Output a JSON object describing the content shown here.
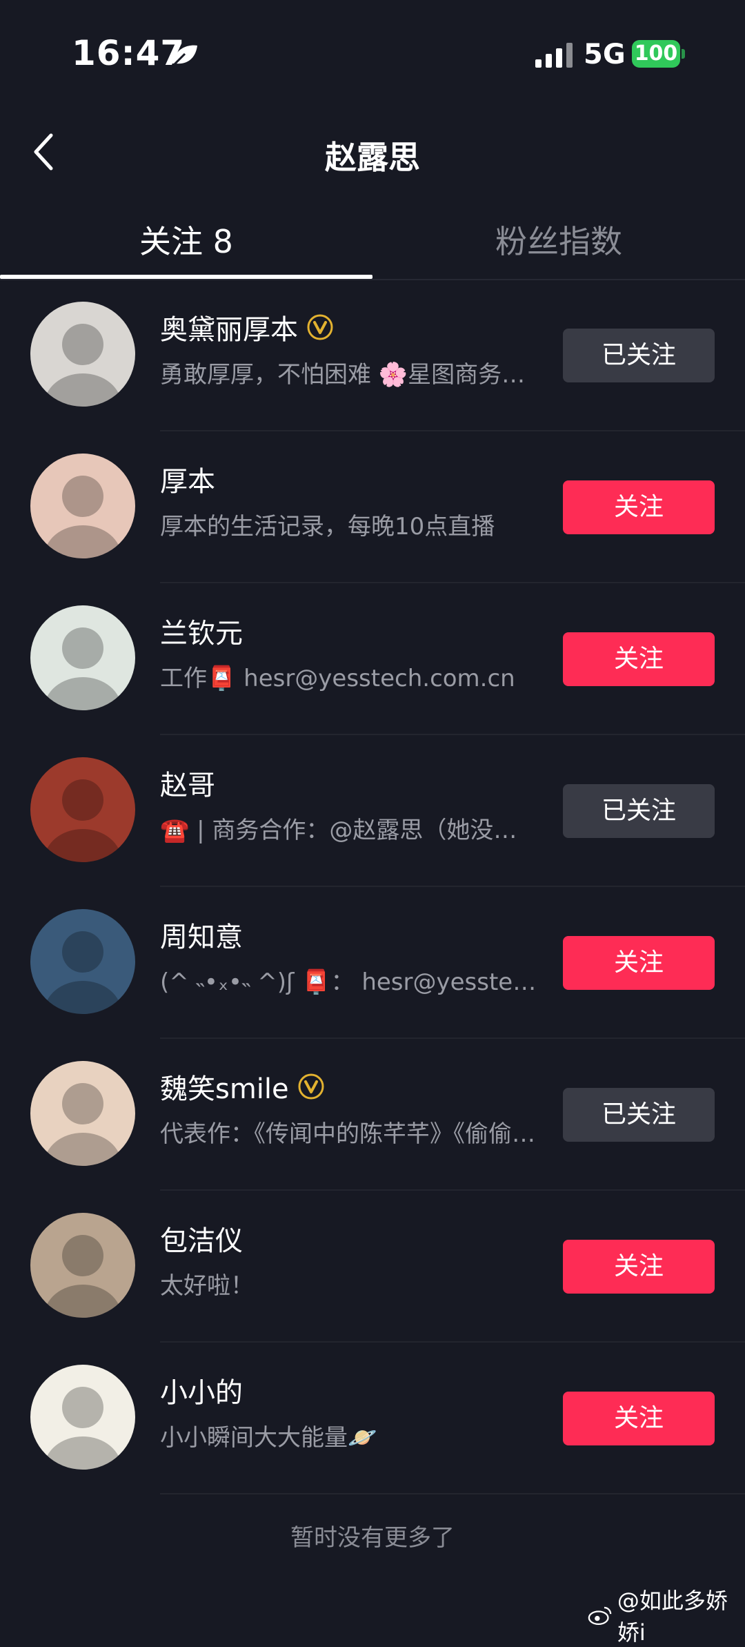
{
  "status_bar": {
    "time": "16:47",
    "network": "5G",
    "battery": "100"
  },
  "header": {
    "title": "赵露思"
  },
  "tabs": [
    {
      "label": "关注 8"
    },
    {
      "label": "粉丝指数"
    }
  ],
  "list": [
    {
      "name": "奥黛丽厚本",
      "verified": true,
      "bio": "勇敢厚厚，不怕困难 🌸星图商务合作",
      "button": "已关注",
      "state": "followed",
      "avatar_color": "#d9d6d2"
    },
    {
      "name": "厚本",
      "verified": false,
      "bio": "厚本的生活记录，每晚10点直播",
      "button": "关注",
      "state": "follow",
      "avatar_color": "#e7c7b9"
    },
    {
      "name": "兰钦元",
      "verified": false,
      "bio": "工作📮 hesr@yesstech.com.cn",
      "button": "关注",
      "state": "follow",
      "avatar_color": "#dfe6e0"
    },
    {
      "name": "赵哥",
      "verified": false,
      "bio": "☎️ | 商务合作：@赵露思（她没空）",
      "button": "已关注",
      "state": "followed",
      "avatar_color": "#9c3a2c"
    },
    {
      "name": "周知意",
      "verified": false,
      "bio": "(^ ˵•ₓ•˵ ^)ʃ       📮： hesr@yesstech",
      "button": "关注",
      "state": "follow",
      "avatar_color": "#3a5a7a"
    },
    {
      "name": "魏笑smile",
      "verified": true,
      "bio": "代表作：《传闻中的陈芊芊》《偷偷藏不住》",
      "button": "已关注",
      "state": "followed",
      "avatar_color": "#e8d2c0"
    },
    {
      "name": "包洁仪",
      "verified": false,
      "bio": "太好啦！",
      "button": "关注",
      "state": "follow",
      "avatar_color": "#b9a48f"
    },
    {
      "name": "小小的",
      "verified": false,
      "bio": "小小瞬间大大能量🪐",
      "button": "关注",
      "state": "follow",
      "avatar_color": "#f2efe6"
    }
  ],
  "footer": {
    "end_text": "暂时没有更多了",
    "watermark": "@如此多娇娇i"
  },
  "colors": {
    "background": "#171923",
    "follow": "#fe2c55",
    "followed": "#393b45",
    "verified": "#e3b230"
  }
}
